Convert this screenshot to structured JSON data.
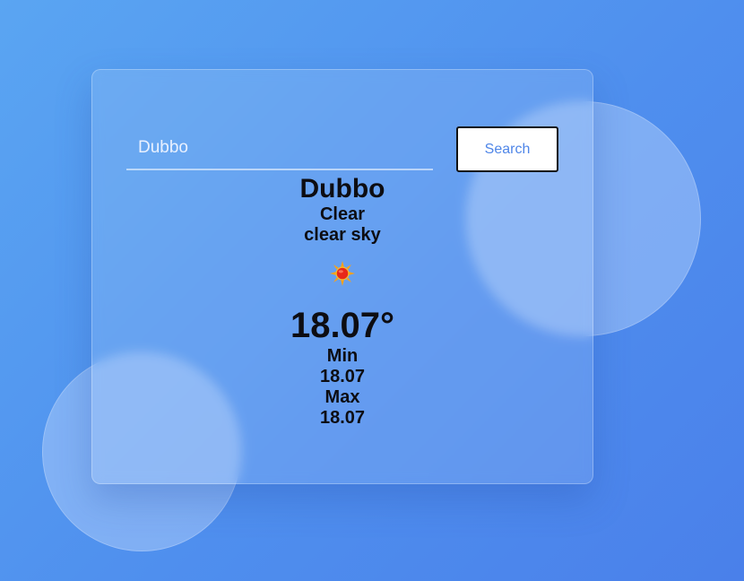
{
  "search": {
    "value": "Dubbo",
    "button_label": "Search"
  },
  "weather": {
    "city": "Dubbo",
    "condition": "Clear",
    "description": "clear sky",
    "icon": "sun-icon",
    "temperature": "18.07°",
    "min_label": "Min",
    "min_value": "18.07",
    "max_label": "Max",
    "max_value": "18.07"
  },
  "colors": {
    "background_start": "#5aa5f2",
    "background_end": "#4a80ea",
    "button_text": "#4f86e8",
    "sun_core": "#e8281a",
    "sun_rays": "#f7a21b"
  }
}
